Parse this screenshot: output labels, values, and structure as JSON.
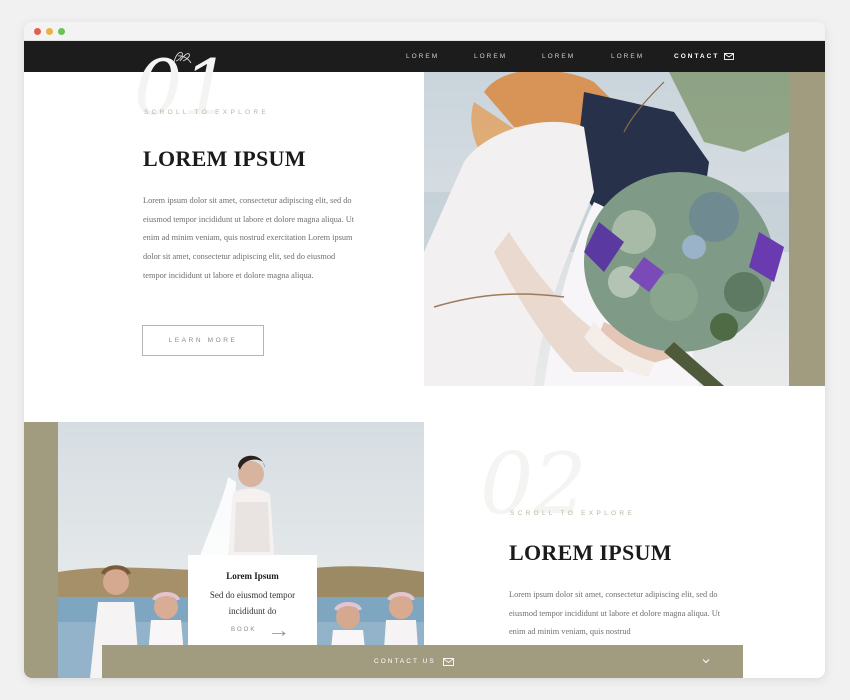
{
  "nav": {
    "links": [
      "LOREM",
      "LOREM",
      "LOREM",
      "LOREM"
    ],
    "contact_label": "CONTACT"
  },
  "section1": {
    "number": "01",
    "eyebrow": "SCROLL TO EXPLORE",
    "heading": "LOREM IPSUM",
    "paragraph": "Lorem ipsum dolor sit amet, consectetur adipiscing elit, sed do eiusmod tempor incididunt ut labore et dolore magna aliqua. Ut enim ad minim veniam, quis nostrud exercitation Lorem ipsum dolor sit amet, consectetur adipiscing elit, sed do eiusmod tempor incididunt ut labore et dolore magna aliqua.",
    "button_label": "LEARN MORE"
  },
  "section2": {
    "number": "02",
    "eyebrow": "SCROLL TO EXPLORE",
    "heading": "LOREM IPSUM",
    "paragraph": "Lorem ipsum dolor sit amet, consectetur adipiscing elit, sed do eiusmod tempor incididunt ut labore et dolore magna aliqua. Ut enim ad minim veniam, quis nostrud",
    "card": {
      "title": "Lorem Ipsum",
      "text": "Sed do eiusmod tempor incididunt do",
      "book_label": "BOOK"
    }
  },
  "contact_bar": {
    "label": "CONTACT US"
  },
  "icons": {
    "logo": "monogram-logo",
    "mail": "envelope-icon",
    "arrow": "arrow-right-icon",
    "chevron": "chevron-down-icon"
  },
  "colors": {
    "accent": "#a19c80",
    "nav_background": "#1c1c1c",
    "heading": "#1b1b1b",
    "eyebrow": "#b9b69d"
  }
}
